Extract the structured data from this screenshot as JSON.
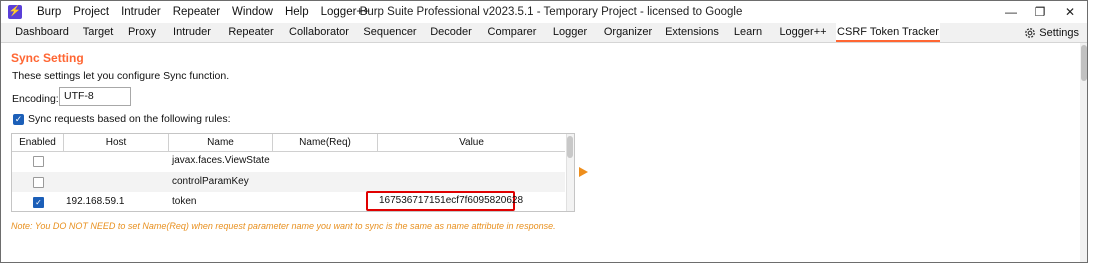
{
  "window": {
    "title": "Burp Suite Professional v2023.5.1 - Temporary Project - licensed to Google",
    "controls": [
      "—",
      "❐",
      "✕"
    ]
  },
  "menubar": [
    "Burp",
    "Project",
    "Intruder",
    "Repeater",
    "Window",
    "Help",
    "Logger++"
  ],
  "tabs": {
    "items": [
      "Dashboard",
      "Target",
      "Proxy",
      "Intruder",
      "Repeater",
      "Collaborator",
      "Sequencer",
      "Decoder",
      "Comparer",
      "Logger",
      "Organizer",
      "Extensions",
      "Learn",
      "Logger++",
      "CSRF Token Tracker"
    ],
    "active": "CSRF Token Tracker",
    "settings_label": "Settings"
  },
  "sync": {
    "title": "Sync Setting",
    "description": "These settings let you configure Sync function.",
    "encoding_label": "Encoding:",
    "encoding_value": "UTF-8",
    "sync_checkbox_label": "Sync requests based on the following rules:",
    "sync_checked": true
  },
  "table": {
    "columns": [
      "Enabled",
      "Host",
      "Name",
      "Name(Req)",
      "Value"
    ],
    "rows": [
      {
        "enabled": false,
        "host": "",
        "name": "javax.faces.ViewState",
        "name_req": "",
        "value": ""
      },
      {
        "enabled": false,
        "host": "",
        "name": "controlParamKey",
        "name_req": "",
        "value": ""
      },
      {
        "enabled": true,
        "host": "192.168.59.1",
        "name": "token",
        "name_req": "",
        "value": "167536717151ecf7f6095820628"
      }
    ]
  },
  "note": "Note: You DO NOT NEED to set Name(Req) when request parameter name you want to sync is the same as name attribute in response.",
  "colors": {
    "accent": "#ff6633",
    "note": "#e8901f",
    "highlight": "#e00000",
    "checkbox": "#1c5fb8"
  }
}
